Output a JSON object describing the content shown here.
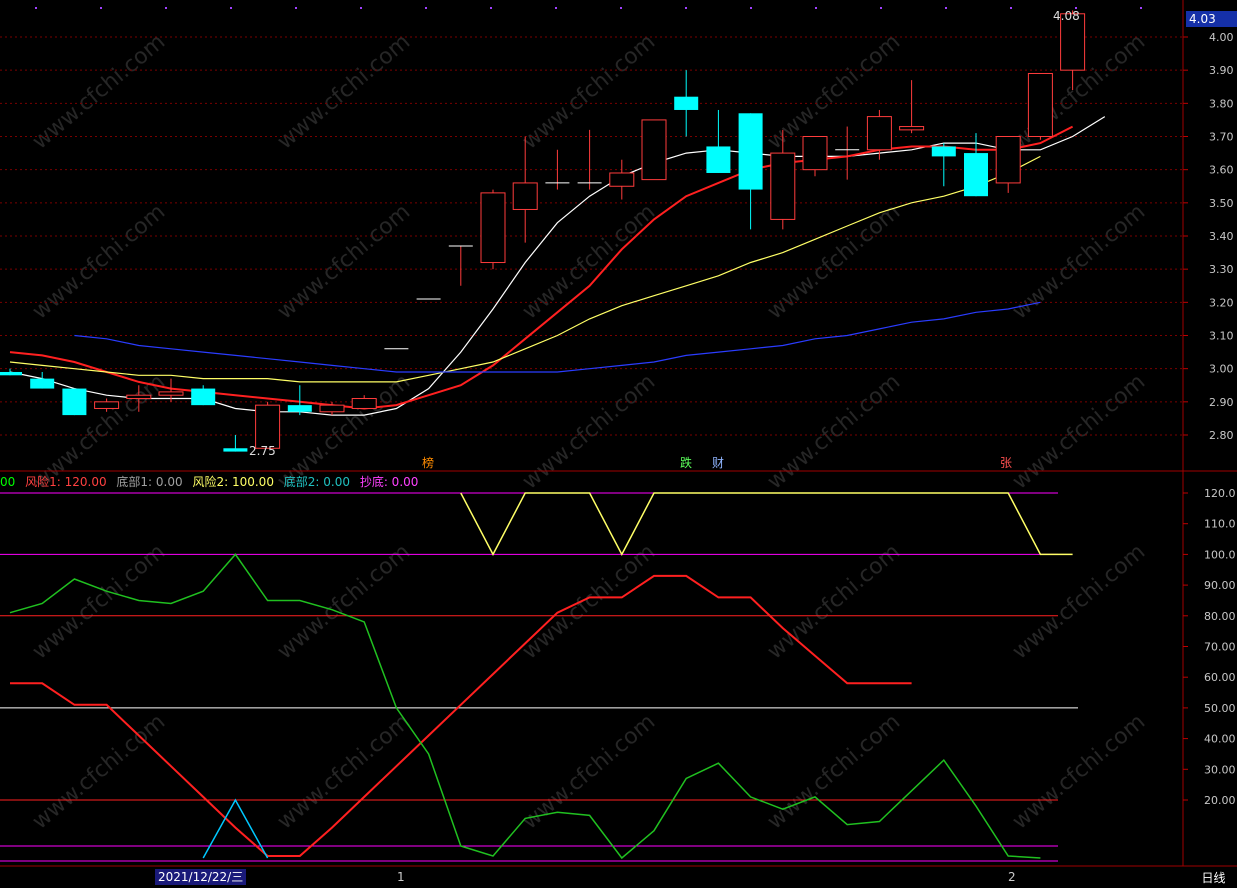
{
  "price_axis": {
    "labels": [
      "4.00",
      "3.90",
      "3.80",
      "3.70",
      "3.60",
      "3.50",
      "3.40",
      "3.30",
      "3.20",
      "3.10",
      "3.00",
      "2.90",
      "2.80"
    ],
    "current": "4.03",
    "high_label": "4.08",
    "low_label": "2.75"
  },
  "indicator_axis": {
    "labels": [
      "120.0",
      "110.0",
      "100.0",
      "90.00",
      "80.00",
      "70.00",
      "60.00",
      "50.00",
      "40.00",
      "30.00",
      "20.00"
    ]
  },
  "legend": {
    "prefix": "00",
    "risk1": "风险1: 120.00",
    "bottom1": "底部1: 0.00",
    "risk2": "风险2: 100.00",
    "bottom2": "底部2: 0.00",
    "chaodi": "抄底: 0.00"
  },
  "signals": [
    {
      "text": "榜",
      "color": "#ff8c00"
    },
    {
      "text": "跌",
      "color": "#5bff5b"
    },
    {
      "text": "财",
      "color": "#8fb4ff"
    },
    {
      "text": "张",
      "color": "#ff5050"
    }
  ],
  "date_label": "2021/12/22/三",
  "month_ticks": [
    "1",
    "2"
  ],
  "period_button": "日线",
  "watermark": "www.cfchi.com",
  "colors": {
    "up": "#ff3c3c",
    "down": "#00ffff",
    "ma5": "#ffffff",
    "ma10": "#ff2020",
    "ma20": "#ffff66",
    "ma60": "#2a3cff"
  },
  "chart_data": {
    "type": "candlestick",
    "candles": [
      {
        "o": 2.99,
        "h": 3.0,
        "l": 2.98,
        "c": 2.98
      },
      {
        "o": 2.97,
        "h": 2.99,
        "l": 2.94,
        "c": 2.94
      },
      {
        "o": 2.94,
        "h": 2.94,
        "l": 2.86,
        "c": 2.86
      },
      {
        "o": 2.88,
        "h": 2.91,
        "l": 2.87,
        "c": 2.9
      },
      {
        "o": 2.91,
        "h": 2.95,
        "l": 2.87,
        "c": 2.92
      },
      {
        "o": 2.92,
        "h": 2.97,
        "l": 2.9,
        "c": 2.93
      },
      {
        "o": 2.94,
        "h": 2.95,
        "l": 2.89,
        "c": 2.89
      },
      {
        "o": 2.76,
        "h": 2.8,
        "l": 2.75,
        "c": 2.75
      },
      {
        "o": 2.76,
        "h": 2.9,
        "l": 2.76,
        "c": 2.89
      },
      {
        "o": 2.89,
        "h": 2.95,
        "l": 2.86,
        "c": 2.87
      },
      {
        "o": 2.87,
        "h": 2.9,
        "l": 2.86,
        "c": 2.89
      },
      {
        "o": 2.88,
        "h": 2.92,
        "l": 2.88,
        "c": 2.91
      },
      {
        "o": 3.06,
        "h": 3.06,
        "l": 3.06,
        "c": 3.06
      },
      {
        "o": 3.21,
        "h": 3.21,
        "l": 3.21,
        "c": 3.21
      },
      {
        "o": 3.37,
        "h": 3.37,
        "l": 3.25,
        "c": 3.37
      },
      {
        "o": 3.32,
        "h": 3.54,
        "l": 3.3,
        "c": 3.53
      },
      {
        "o": 3.48,
        "h": 3.7,
        "l": 3.38,
        "c": 3.56
      },
      {
        "o": 3.56,
        "h": 3.66,
        "l": 3.54,
        "c": 3.56
      },
      {
        "o": 3.56,
        "h": 3.72,
        "l": 3.54,
        "c": 3.56
      },
      {
        "o": 3.55,
        "h": 3.63,
        "l": 3.51,
        "c": 3.59
      },
      {
        "o": 3.57,
        "h": 3.75,
        "l": 3.57,
        "c": 3.75
      },
      {
        "o": 3.82,
        "h": 3.9,
        "l": 3.7,
        "c": 3.78
      },
      {
        "o": 3.67,
        "h": 3.78,
        "l": 3.59,
        "c": 3.59
      },
      {
        "o": 3.77,
        "h": 3.77,
        "l": 3.42,
        "c": 3.54
      },
      {
        "o": 3.45,
        "h": 3.72,
        "l": 3.42,
        "c": 3.65
      },
      {
        "o": 3.6,
        "h": 3.7,
        "l": 3.58,
        "c": 3.7
      },
      {
        "o": 3.66,
        "h": 3.73,
        "l": 3.57,
        "c": 3.66
      },
      {
        "o": 3.66,
        "h": 3.78,
        "l": 3.63,
        "c": 3.76
      },
      {
        "o": 3.72,
        "h": 3.87,
        "l": 3.71,
        "c": 3.73
      },
      {
        "o": 3.67,
        "h": 3.68,
        "l": 3.55,
        "c": 3.64
      },
      {
        "o": 3.65,
        "h": 3.71,
        "l": 3.52,
        "c": 3.52
      },
      {
        "o": 3.56,
        "h": 3.7,
        "l": 3.53,
        "c": 3.7
      },
      {
        "o": 3.7,
        "h": 3.89,
        "l": 3.69,
        "c": 3.89
      },
      {
        "o": 3.9,
        "h": 4.08,
        "l": 3.84,
        "c": 4.07
      }
    ],
    "ma": [
      {
        "name": "MA5",
        "color": "#ffffff",
        "values": [
          2.99,
          2.97,
          2.94,
          2.92,
          2.91,
          2.91,
          2.91,
          2.88,
          2.87,
          2.87,
          2.86,
          2.86,
          2.88,
          2.94,
          3.05,
          3.18,
          3.32,
          3.44,
          3.52,
          3.58,
          3.62,
          3.65,
          3.66,
          3.65,
          3.64,
          3.64,
          3.64,
          3.65,
          3.66,
          3.68,
          3.68,
          3.66,
          3.66,
          3.7,
          3.76
        ]
      },
      {
        "name": "MA10",
        "color": "#ff2020",
        "values": [
          3.05,
          3.04,
          3.02,
          2.99,
          2.96,
          2.94,
          2.93,
          2.92,
          2.91,
          2.9,
          2.89,
          2.88,
          2.89,
          2.92,
          2.95,
          3.01,
          3.09,
          3.17,
          3.25,
          3.36,
          3.45,
          3.52,
          3.56,
          3.6,
          3.62,
          3.63,
          3.64,
          3.66,
          3.67,
          3.67,
          3.66,
          3.66,
          3.68,
          3.73
        ]
      },
      {
        "name": "MA20",
        "color": "#ffff66",
        "values": [
          3.02,
          3.01,
          3.0,
          2.99,
          2.98,
          2.98,
          2.97,
          2.97,
          2.97,
          2.96,
          2.96,
          2.96,
          2.96,
          2.98,
          3.0,
          3.02,
          3.06,
          3.1,
          3.15,
          3.19,
          3.22,
          3.25,
          3.28,
          3.32,
          3.35,
          3.39,
          3.43,
          3.47,
          3.5,
          3.52,
          3.55,
          3.59,
          3.64
        ]
      },
      {
        "name": "MA60",
        "color": "#2a3cff",
        "values": [
          3.1,
          3.09,
          3.07,
          3.06,
          3.05,
          3.04,
          3.03,
          3.02,
          3.01,
          3.0,
          2.99,
          2.99,
          2.99,
          2.99,
          2.99,
          2.99,
          3.0,
          3.01,
          3.02,
          3.04,
          3.05,
          3.06,
          3.07,
          3.09,
          3.1,
          3.12,
          3.14,
          3.15,
          3.17,
          3.18,
          3.2
        ]
      }
    ],
    "ylim": [
      2.72,
      4.1
    ],
    "indicator": {
      "ylim": [
        0,
        125
      ],
      "hlines": [
        {
          "value": 120,
          "color": "#ff00ff"
        },
        {
          "value": 100,
          "color": "#ff00ff"
        },
        {
          "value": 80,
          "color": "#ff2020"
        },
        {
          "value": 50,
          "color": "#ffffff"
        },
        {
          "value": 20,
          "color": "#ff2020"
        },
        {
          "value": 5,
          "color": "#ff00ff"
        },
        {
          "value": 0,
          "color": "#ff00ff"
        }
      ],
      "series": [
        {
          "name": "风险2",
          "color": "#ffff66",
          "values": [
            null,
            null,
            null,
            null,
            null,
            null,
            null,
            null,
            null,
            null,
            null,
            null,
            null,
            null,
            120,
            100,
            120,
            120,
            120,
            100,
            120,
            120,
            120,
            120,
            120,
            120,
            120,
            120,
            120,
            120,
            120,
            120,
            100,
            100
          ]
        },
        {
          "name": "风险1",
          "color": "#ff2020",
          "values": [
            58,
            58,
            51,
            51,
            41,
            31,
            21,
            11,
            1,
            1,
            11,
            21,
            31,
            41,
            51,
            61,
            71,
            81,
            86,
            86,
            93,
            93,
            86,
            86,
            76,
            67,
            58,
            58,
            58
          ]
        },
        {
          "name": "绿线",
          "color": "#20c020",
          "values": [
            81,
            84,
            92,
            88,
            85,
            84,
            88,
            100,
            85,
            85,
            82,
            78,
            50,
            35,
            5,
            1,
            14,
            16,
            15,
            0,
            10,
            27,
            32,
            21,
            17,
            21,
            12,
            13,
            23,
            33,
            18,
            1,
            0
          ]
        },
        {
          "name": "抄底",
          "color": "#00c8ff",
          "values": [
            null,
            null,
            null,
            null,
            null,
            null,
            0,
            20,
            0
          ]
        }
      ]
    }
  }
}
